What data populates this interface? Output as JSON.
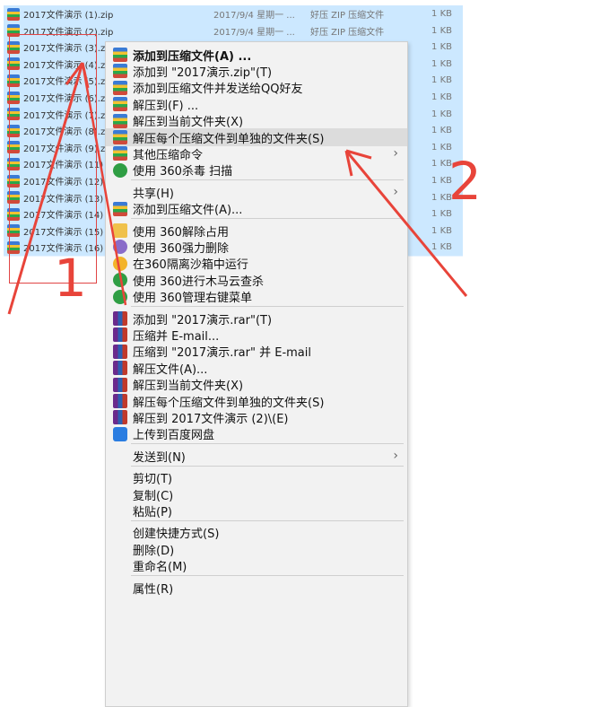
{
  "files": [
    {
      "name": "2017文件演示 (1).zip",
      "date": "2017/9/4 星期一 ...",
      "type": "好压 ZIP 压缩文件",
      "size": "1 KB"
    },
    {
      "name": "2017文件演示 (2).zip",
      "date": "2017/9/4 星期一 ...",
      "type": "好压 ZIP 压缩文件",
      "size": "1 KB"
    },
    {
      "name": "2017文件演示 (3).z",
      "date": "",
      "type": "",
      "size": "1 KB"
    },
    {
      "name": "2017文件演示 (4).z",
      "date": "",
      "type": "",
      "size": "1 KB"
    },
    {
      "name": "2017文件演示 (5).z",
      "date": "",
      "type": "",
      "size": "1 KB"
    },
    {
      "name": "2017文件演示 (6).z",
      "date": "",
      "type": "",
      "size": "1 KB"
    },
    {
      "name": "2017文件演示 (7).z",
      "date": "",
      "type": "",
      "size": "1 KB"
    },
    {
      "name": "2017文件演示 (8).z",
      "date": "",
      "type": "",
      "size": "1 KB"
    },
    {
      "name": "2017文件演示 (9).z",
      "date": "",
      "type": "",
      "size": "1 KB"
    },
    {
      "name": "2017文件演示 (11)",
      "date": "",
      "type": "",
      "size": "1 KB"
    },
    {
      "name": "2017文件演示 (12)",
      "date": "",
      "type": "",
      "size": "1 KB"
    },
    {
      "name": "2017文件演示 (13)",
      "date": "",
      "type": "",
      "size": "1 KB"
    },
    {
      "name": "2017文件演示 (14)",
      "date": "",
      "type": "",
      "size": "1 KB"
    },
    {
      "name": "2017文件演示 (15)",
      "date": "",
      "type": "",
      "size": "1 KB"
    },
    {
      "name": "2017文件演示 (16)",
      "date": "",
      "type": "",
      "size": "1 KB"
    }
  ],
  "menu": [
    {
      "label": "添加到压缩文件(A) ...",
      "icon": "zip",
      "bold": true
    },
    {
      "label": "添加到 \"2017演示.zip\"(T)",
      "icon": "zip"
    },
    {
      "label": "添加到压缩文件并发送给QQ好友",
      "icon": "zip"
    },
    {
      "label": "解压到(F) ...",
      "icon": "zip"
    },
    {
      "label": "解压到当前文件夹(X)",
      "icon": "zip"
    },
    {
      "label": "解压每个压缩文件到单独的文件夹(S)",
      "icon": "zip",
      "highlight": true
    },
    {
      "label": "其他压缩命令",
      "icon": "zip",
      "arrow": true
    },
    {
      "label": "使用 360杀毒 扫描",
      "icon": "green"
    },
    {
      "sep": true
    },
    {
      "label": "共享(H)",
      "icon": "",
      "arrow": true
    },
    {
      "label": "添加到压缩文件(A)...",
      "icon": "zip"
    },
    {
      "sep": true
    },
    {
      "label": "使用 360解除占用",
      "icon": "folder"
    },
    {
      "label": "使用 360强力删除",
      "icon": "purple"
    },
    {
      "label": "在360隔离沙箱中运行",
      "icon": "yellow"
    },
    {
      "label": "使用 360进行木马云查杀",
      "icon": "green"
    },
    {
      "label": "使用 360管理右键菜单",
      "icon": "green"
    },
    {
      "sep": true
    },
    {
      "label": "添加到 \"2017演示.rar\"(T)",
      "icon": "rar"
    },
    {
      "label": "压缩并 E-mail...",
      "icon": "rar"
    },
    {
      "label": "压缩到 \"2017演示.rar\" 并 E-mail",
      "icon": "rar"
    },
    {
      "label": "解压文件(A)...",
      "icon": "rar"
    },
    {
      "label": "解压到当前文件夹(X)",
      "icon": "rar"
    },
    {
      "label": "解压每个压缩文件到单独的文件夹(S)",
      "icon": "rar"
    },
    {
      "label": "解压到 2017文件演示 (2)\\(E)",
      "icon": "rar"
    },
    {
      "label": "上传到百度网盘",
      "icon": "blue"
    },
    {
      "sep": true
    },
    {
      "label": "发送到(N)",
      "icon": "",
      "arrow": true
    },
    {
      "sep": true
    },
    {
      "label": "剪切(T)",
      "icon": ""
    },
    {
      "label": "复制(C)",
      "icon": ""
    },
    {
      "label": "粘贴(P)",
      "icon": ""
    },
    {
      "sep": true
    },
    {
      "label": "创建快捷方式(S)",
      "icon": ""
    },
    {
      "label": "删除(D)",
      "icon": ""
    },
    {
      "label": "重命名(M)",
      "icon": ""
    },
    {
      "sep": true
    },
    {
      "label": "属性(R)",
      "icon": ""
    }
  ],
  "annotations": {
    "label1": "1",
    "label2": "2",
    "color": "#e8443a"
  },
  "colors": {
    "selection": "#cce8ff",
    "menu_bg": "#f2f2f2",
    "menu_highlight": "#dcdcdc"
  }
}
